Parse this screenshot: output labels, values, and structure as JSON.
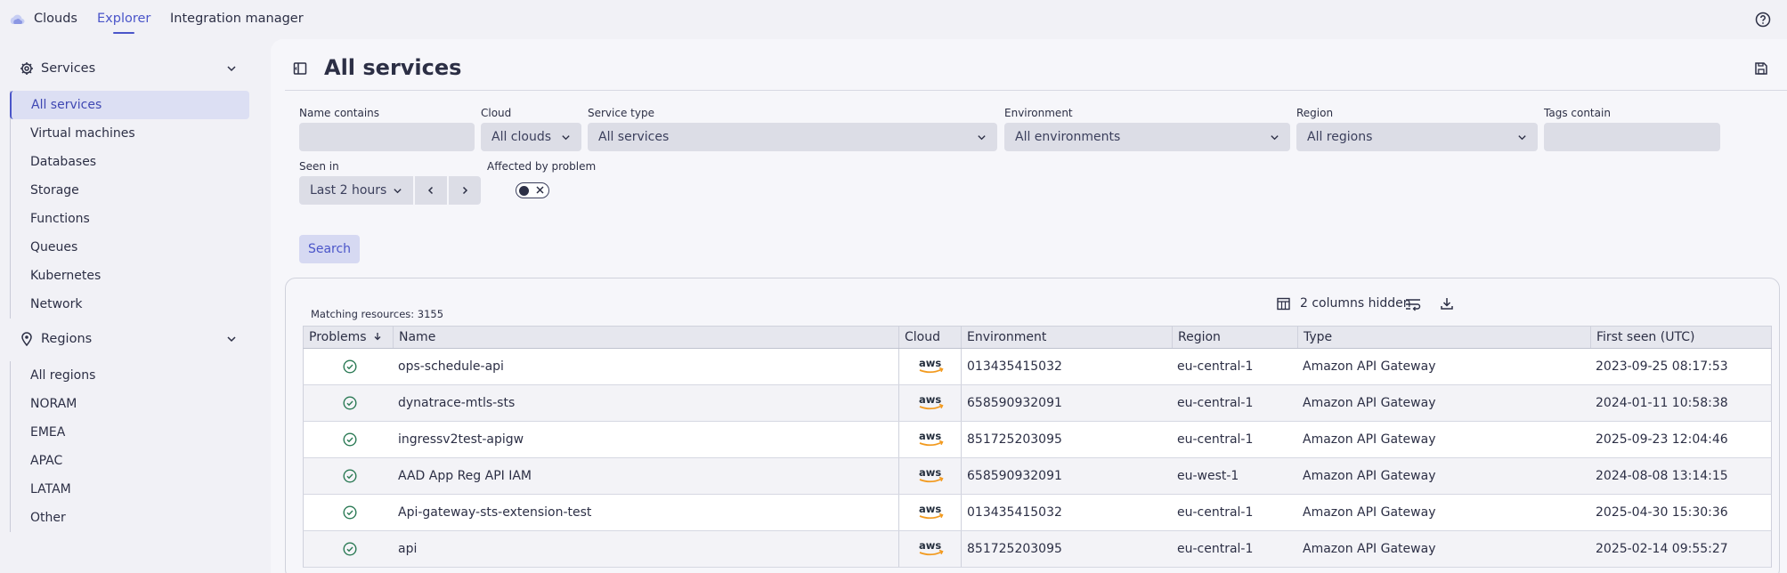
{
  "topbar": {
    "tabs": [
      "Clouds",
      "Explorer",
      "Integration manager"
    ],
    "active_tab": "Explorer"
  },
  "sidebar": {
    "services_label": "Services",
    "services": [
      "All services",
      "Virtual machines",
      "Databases",
      "Storage",
      "Functions",
      "Queues",
      "Kubernetes",
      "Network"
    ],
    "regions_label": "Regions",
    "regions": [
      "All regions",
      "NORAM",
      "EMEA",
      "APAC",
      "LATAM",
      "Other"
    ]
  },
  "page": {
    "title": "All services"
  },
  "filters": {
    "name_contains_label": "Name contains",
    "cloud_label": "Cloud",
    "cloud_value": "All clouds",
    "service_type_label": "Service type",
    "service_type_value": "All services",
    "environment_label": "Environment",
    "environment_value": "All environments",
    "region_label": "Region",
    "region_value": "All regions",
    "tags_label": "Tags contain",
    "seen_in_label": "Seen in",
    "seen_in_value": "Last 2 hours",
    "affected_label": "Affected by problem",
    "search_label": "Search"
  },
  "results": {
    "matching": "Matching resources: 3155",
    "hidden_columns": "2 columns hidden",
    "columns": [
      "Problems",
      "Name",
      "Cloud",
      "Environment",
      "Region",
      "Type",
      "First seen (UTC)"
    ],
    "rows": [
      {
        "name": "ops-schedule-api",
        "cloud": "aws",
        "environment": "013435415032",
        "region": "eu-central-1",
        "type": "Amazon API Gateway",
        "first_seen": "2023-09-25 08:17:53"
      },
      {
        "name": "dynatrace-mtls-sts",
        "cloud": "aws",
        "environment": "658590932091",
        "region": "eu-central-1",
        "type": "Amazon API Gateway",
        "first_seen": "2024-01-11 10:58:38"
      },
      {
        "name": "ingressv2test-apigw",
        "cloud": "aws",
        "environment": "851725203095",
        "region": "eu-central-1",
        "type": "Amazon API Gateway",
        "first_seen": "2025-09-23 12:04:46"
      },
      {
        "name": "AAD App Reg API IAM",
        "cloud": "aws",
        "environment": "658590932091",
        "region": "eu-west-1",
        "type": "Amazon API Gateway",
        "first_seen": "2024-08-08 13:14:15"
      },
      {
        "name": "Api-gateway-sts-extension-test",
        "cloud": "aws",
        "environment": "013435415032",
        "region": "eu-central-1",
        "type": "Amazon API Gateway",
        "first_seen": "2025-04-30 15:30:36"
      },
      {
        "name": "api",
        "cloud": "aws",
        "environment": "851725203095",
        "region": "eu-central-1",
        "type": "Amazon API Gateway",
        "first_seen": "2025-02-14 09:55:27"
      }
    ]
  },
  "colors": {
    "accent": "#4a55c9",
    "aws_orange": "#f29a1f",
    "ok_green": "#2b7a55"
  }
}
